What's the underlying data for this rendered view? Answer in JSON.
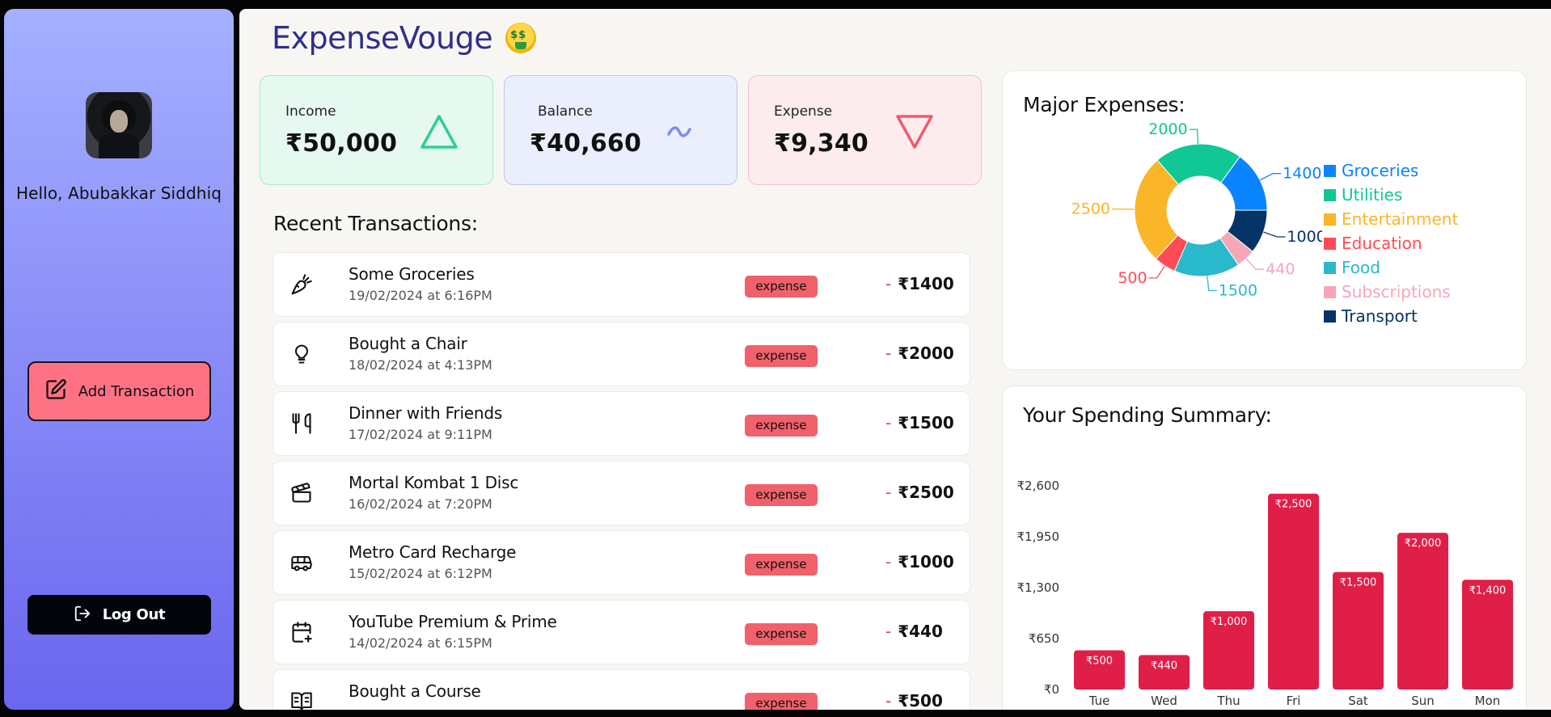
{
  "app": {
    "name": "ExpenseVouge"
  },
  "sidebar": {
    "greeting": "Hello, Abubakkar Siddhiq",
    "add_transaction_label": "Add Transaction",
    "logout_label": "Log Out"
  },
  "summary": {
    "income": {
      "label": "Income",
      "value": "₹50,000",
      "icon": "triangle-up-icon",
      "color": "#2ccf95"
    },
    "balance": {
      "label": "Balance",
      "value": "₹40,660",
      "icon": "tilde-icon",
      "color": "#7b8cf0"
    },
    "expense": {
      "label": "Expense",
      "value": "₹9,340",
      "icon": "triangle-down-icon",
      "color": "#f05a6c"
    }
  },
  "transactions": {
    "title": "Recent Transactions:",
    "items": [
      {
        "icon": "carrot-icon",
        "name": "Some Groceries",
        "date": "19/02/2024 at 6:16PM",
        "type": "expense",
        "sign": "-",
        "amount": "₹1400"
      },
      {
        "icon": "lightbulb-icon",
        "name": "Bought a Chair",
        "date": "18/02/2024 at 4:13PM",
        "type": "expense",
        "sign": "-",
        "amount": "₹2000"
      },
      {
        "icon": "utensils-icon",
        "name": "Dinner with Friends",
        "date": "17/02/2024 at 9:11PM",
        "type": "expense",
        "sign": "-",
        "amount": "₹1500"
      },
      {
        "icon": "clapperboard-icon",
        "name": "Mortal Kombat 1 Disc",
        "date": "16/02/2024 at 7:20PM",
        "type": "expense",
        "sign": "-",
        "amount": "₹2500"
      },
      {
        "icon": "bus-icon",
        "name": "Metro Card Recharge",
        "date": "15/02/2024 at 6:12PM",
        "type": "expense",
        "sign": "-",
        "amount": "₹1000"
      },
      {
        "icon": "calendar-plus-icon",
        "name": "YouTube Premium & Prime",
        "date": "14/02/2024 at 6:15PM",
        "type": "expense",
        "sign": "-",
        "amount": "₹440"
      },
      {
        "icon": "book-open-icon",
        "name": "Bought a Course",
        "date": "",
        "type": "expense",
        "sign": "-",
        "amount": "₹500"
      }
    ]
  },
  "major_expenses": {
    "title": "Major Expenses:",
    "chart_data": {
      "type": "pie",
      "donut": true,
      "slices": [
        {
          "name": "Groceries",
          "value": 1400,
          "color": "#0a84ff"
        },
        {
          "name": "Utilities",
          "value": 2000,
          "color": "#10c795"
        },
        {
          "name": "Entertainment",
          "value": 2500,
          "color": "#fbb528"
        },
        {
          "name": "Education",
          "value": 500,
          "color": "#ff4b55"
        },
        {
          "name": "Food",
          "value": 1500,
          "color": "#2ab9cb"
        },
        {
          "name": "Subscriptions",
          "value": 440,
          "color": "#f6a6b7"
        },
        {
          "name": "Transport",
          "value": 1000,
          "color": "#063365"
        }
      ],
      "legend_position": "right"
    }
  },
  "spending_summary": {
    "title": "Your Spending Summary:",
    "chart_data": {
      "type": "bar",
      "categories": [
        "Tue",
        "Wed",
        "Thu",
        "Fri",
        "Sat",
        "Sun",
        "Mon"
      ],
      "values": [
        500,
        440,
        1000,
        2500,
        1500,
        2000,
        1400
      ],
      "value_labels": [
        "₹500",
        "₹440",
        "₹1,000",
        "₹2,500",
        "₹1,500",
        "₹2,000",
        "₹1,400"
      ],
      "y_ticks": [
        0,
        650,
        1300,
        1950,
        2600
      ],
      "y_tick_labels": [
        "₹0",
        "₹650",
        "₹1,300",
        "₹1,950",
        "₹2,600"
      ],
      "ylim": [
        0,
        2600
      ],
      "bar_color": "#e01f48",
      "grid": false
    }
  }
}
